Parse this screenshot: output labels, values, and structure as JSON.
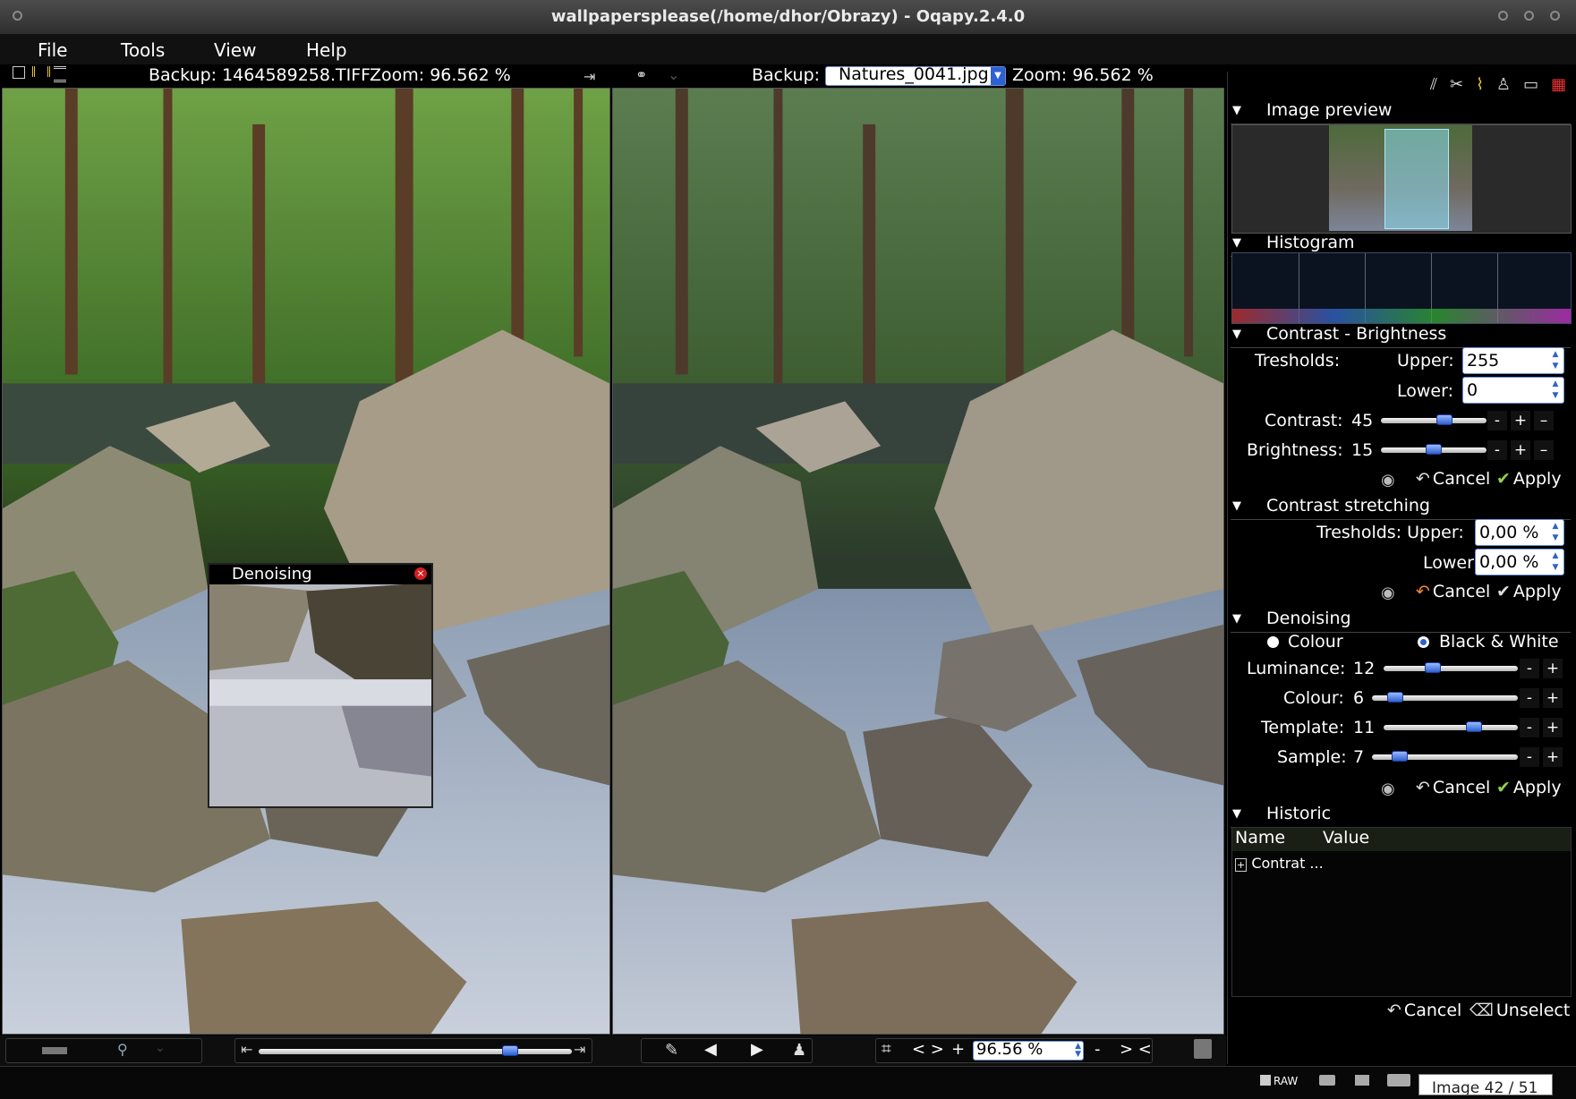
{
  "window": {
    "title": "wallpapersplease(/home/dhor/Obrazy) - Oqapy.2.4.0"
  },
  "menu": [
    "File",
    "Tools",
    "View",
    "Help"
  ],
  "left_view": {
    "backup_label": "Backup: 1464589258.TIFF",
    "zoom_label": "Zoom: 96.562 %"
  },
  "right_view": {
    "backup_label": "Backup:",
    "backup_select": "Natures_0041.jpg",
    "zoom_label": "Zoom: 96.562 %"
  },
  "floating_window": {
    "title": "Denoising"
  },
  "panel": {
    "image_preview": {
      "title": "Image preview"
    },
    "histogram": {
      "title": "Histogram"
    },
    "contrast_brightness": {
      "title": "Contrast - Brightness",
      "tresholds_label": "Tresholds:",
      "upper_label": "Upper:",
      "upper_value": "255",
      "lower_label": "Lower:",
      "lower_value": "0",
      "contrast_label": "Contrast:",
      "contrast_value": "45",
      "contrast_fraction": 0.62,
      "brightness_label": "Brightness:",
      "brightness_value": "15",
      "brightness_fraction": 0.5,
      "cancel": "Cancel",
      "apply": "Apply"
    },
    "contrast_stretching": {
      "title": "Contrast stretching",
      "upper_label": "Tresholds: Upper:",
      "upper_value": "0,00 %",
      "lower_label": "Lower:",
      "lower_value": "0,00 %",
      "cancel": "Cancel",
      "apply": "Apply"
    },
    "denoising": {
      "title": "Denoising",
      "colour_option": "Colour",
      "bw_option": "Black & White",
      "selected": "Black & White",
      "luminance_label": "Luminance:",
      "luminance_value": "12",
      "luminance_fraction": 0.35,
      "colour_label": "Colour:",
      "colour_value": "6",
      "colour_fraction": 0.12,
      "template_label": "Template:",
      "template_value": "11",
      "template_fraction": 0.7,
      "sample_label": "Sample:",
      "sample_value": "7",
      "sample_fraction": 0.15,
      "cancel": "Cancel",
      "apply": "Apply"
    },
    "historic": {
      "title": "Historic",
      "col_name": "Name",
      "col_value": "Value",
      "rows": [
        "Contrat ..."
      ],
      "cancel": "Cancel",
      "unselect": "Unselect"
    }
  },
  "bottom": {
    "zoom_value": "96.56 %",
    "nav_lr": "< >",
    "plus": "+",
    "minus": "-",
    "nav_rl": "> <",
    "timeline_fraction": 0.82
  },
  "status": {
    "raw": "RAW",
    "image_counter": "Image 42 / 51"
  },
  "colors": {
    "accent": "#2e61d2",
    "apply_check": "#8fd14f",
    "cancel_arrow": "#f08a2a"
  }
}
